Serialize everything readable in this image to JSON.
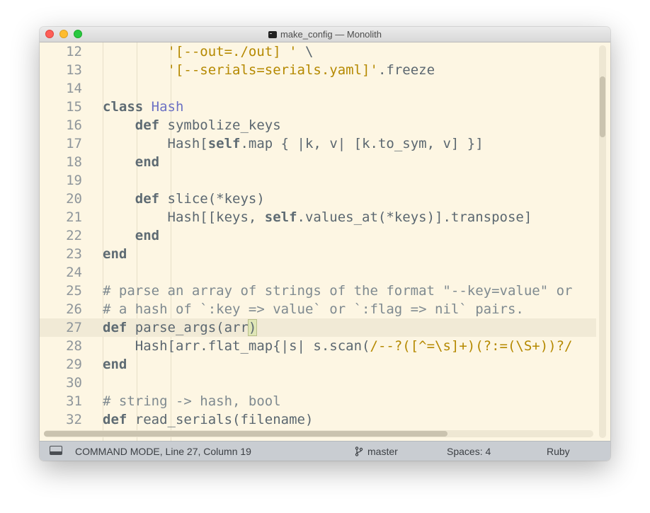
{
  "window": {
    "title": "make_config — Monolith"
  },
  "editor": {
    "current_line": 27,
    "lines": [
      {
        "n": "12",
        "segments": [
          [
            "        ",
            ""
          ],
          [
            "'[--out=./out] '",
            "str"
          ],
          [
            " \\",
            ""
          ]
        ]
      },
      {
        "n": "13",
        "segments": [
          [
            "        ",
            ""
          ],
          [
            "'[--serials=serials.yaml]'",
            "str"
          ],
          [
            ".freeze",
            ""
          ]
        ]
      },
      {
        "n": "14",
        "segments": []
      },
      {
        "n": "15",
        "segments": [
          [
            "class",
            "kw"
          ],
          [
            " ",
            ""
          ],
          [
            "Hash",
            "cls"
          ]
        ]
      },
      {
        "n": "16",
        "segments": [
          [
            "    ",
            ""
          ],
          [
            "def",
            "kw"
          ],
          [
            " symbolize_keys",
            ""
          ]
        ]
      },
      {
        "n": "17",
        "segments": [
          [
            "        Hash[",
            ""
          ],
          [
            "self",
            "kw"
          ],
          [
            ".map { |k, v| [k.to_sym, v] }]",
            ""
          ]
        ]
      },
      {
        "n": "18",
        "segments": [
          [
            "    ",
            ""
          ],
          [
            "end",
            "kw"
          ]
        ]
      },
      {
        "n": "19",
        "segments": []
      },
      {
        "n": "20",
        "segments": [
          [
            "    ",
            ""
          ],
          [
            "def",
            "kw"
          ],
          [
            " slice(*keys)",
            ""
          ]
        ]
      },
      {
        "n": "21",
        "segments": [
          [
            "        Hash[[keys, ",
            ""
          ],
          [
            "self",
            "kw"
          ],
          [
            ".values_at(*keys)].transpose]",
            ""
          ]
        ]
      },
      {
        "n": "22",
        "segments": [
          [
            "    ",
            ""
          ],
          [
            "end",
            "kw"
          ]
        ]
      },
      {
        "n": "23",
        "segments": [
          [
            "end",
            "kw"
          ]
        ]
      },
      {
        "n": "24",
        "segments": []
      },
      {
        "n": "25",
        "segments": [
          [
            "# parse an array of strings of the format \"--key=value\" or",
            "cmt"
          ]
        ]
      },
      {
        "n": "26",
        "segments": [
          [
            "# a hash of `:key => value` or `:flag => nil` pairs.",
            "cmt"
          ]
        ]
      },
      {
        "n": "27",
        "segments": [
          [
            "def",
            "kw"
          ],
          [
            " parse_args(arr",
            ""
          ],
          [
            ")",
            "paren-hl"
          ]
        ]
      },
      {
        "n": "28",
        "segments": [
          [
            "    Hash[arr.flat_map{|s| s.scan(",
            ""
          ],
          [
            "/--?([^=\\s]+)(?:=(\\S+))?/",
            "str"
          ]
        ]
      },
      {
        "n": "29",
        "segments": [
          [
            "end",
            "kw"
          ]
        ]
      },
      {
        "n": "30",
        "segments": []
      },
      {
        "n": "31",
        "segments": [
          [
            "# string -> hash, bool",
            "cmt"
          ]
        ]
      },
      {
        "n": "32",
        "segments": [
          [
            "def",
            "kw"
          ],
          [
            " read_serials(filename)",
            ""
          ]
        ]
      }
    ]
  },
  "statusbar": {
    "mode": "COMMAND MODE, Line 27, Column 19",
    "branch": "master",
    "spaces": "Spaces: 4",
    "syntax": "Ruby",
    "panel_icon": "panel-toggle-icon",
    "branch_icon": "git-branch-icon"
  }
}
